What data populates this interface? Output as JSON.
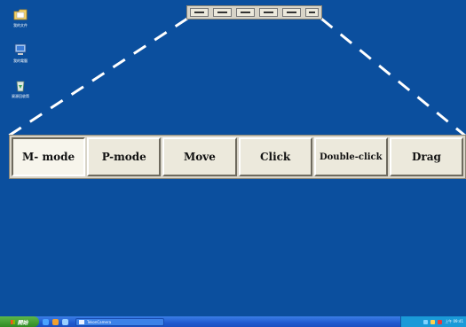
{
  "desktop": {
    "icons": [
      {
        "label": "我的文件",
        "icon": "folder-icon"
      },
      {
        "label": "我的電腦",
        "icon": "computer-icon"
      },
      {
        "label": "資源回收筒",
        "icon": "recycle-bin-icon"
      }
    ]
  },
  "mini_toolbar": {
    "buttons": [
      "minimized-mode-button-1",
      "minimized-mode-button-2",
      "minimized-mode-button-3",
      "minimized-mode-button-4",
      "minimized-mode-button-5",
      "minimized-mode-button-6"
    ]
  },
  "toolbar": {
    "buttons": [
      {
        "label": "M- mode",
        "active": true
      },
      {
        "label": "P-mode",
        "active": false
      },
      {
        "label": "Move",
        "active": false
      },
      {
        "label": "Click",
        "active": false
      },
      {
        "label": "Double-click",
        "active": false
      },
      {
        "label": "Drag",
        "active": false
      }
    ]
  },
  "taskbar": {
    "start_label": "開始",
    "task_item_label": "TekonCamera",
    "clock": "上午 09:41"
  },
  "colors": {
    "desktop": "#0b4f9e",
    "toolbar": "#d8d4c8",
    "button": "#ece9dc",
    "taskbar": "#1f5ad0",
    "start": "#3a9a2c"
  }
}
